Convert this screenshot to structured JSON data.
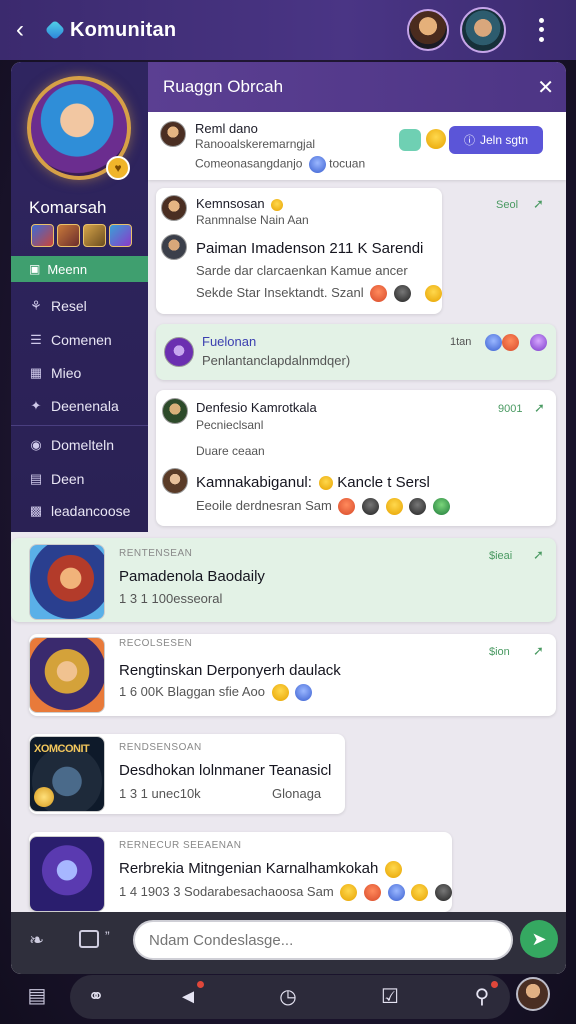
{
  "topbar": {
    "title": "Komunitan"
  },
  "sidebar": {
    "title": "Komarsah",
    "active_item": "Meenn",
    "items": [
      {
        "label": "Resel",
        "icon": "group-icon"
      },
      {
        "label": "Comenen",
        "icon": "list-icon"
      },
      {
        "label": "Mieo",
        "icon": "calendar-icon"
      },
      {
        "label": "Deenenala",
        "icon": "star-icon"
      },
      {
        "label": "Domelteln",
        "icon": "chat-icon"
      },
      {
        "label": "Deen",
        "icon": "document-icon"
      },
      {
        "label": "leadancoose",
        "icon": "image-icon"
      }
    ]
  },
  "panel": {
    "title": "Ruaggn Obrcah"
  },
  "pinned": {
    "name": "Reml dano",
    "line1": "Ranooalskeremarngjal",
    "line2": "Comeonasangdanjo",
    "line2_tail": "tocuan",
    "join_label": "Jeln sgtn"
  },
  "messages": [
    {
      "name": "Kemnsosan",
      "sub": "Ranmnalse Nain Aan",
      "main": "Paiman Imadenson 211 K Sarendi",
      "line2": "Sarde dar clarcaenkan Kamue ancer",
      "line3": "Sekde Star Insektandt. Szanl",
      "time": "Seol"
    },
    {
      "name": "Fuelonan",
      "sub": "Penlantanclapdalnmdqer)",
      "time": "1tan"
    },
    {
      "name": "Denfesio Kamrotkala",
      "sub": "Pecnieclsanl",
      "sub2": "Duare ceaan",
      "main": "Kamnakabiganul:",
      "main_tail": "Kancle t Sersl",
      "line3": "Eeoile derdnesran Sam",
      "time": "9001"
    }
  ],
  "games": [
    {
      "tag": "RENTENSEAN",
      "title": "Pamadenola Baodaily",
      "sub": "1 3  1 100esseoral",
      "time": "$ieai"
    },
    {
      "tag": "RECOLSESEN",
      "title": "Rengtinskan Derponyerh daulack",
      "sub": "1 6  00K Blaggan sfie Aoo",
      "time": "$ion"
    },
    {
      "tag": "RENDSENSOAN",
      "title": "Desdhokan lolnmaner Teanasicl",
      "sub": "1 3  1 unec10k",
      "extra": "Glonaga",
      "thumb_label": "XOMCONIT"
    },
    {
      "tag": "RERNECUR SEEAENAN",
      "title": "Rerbrekia Mitngenian Karnalhamkokah",
      "sub": "1 4 1903 3 Sodarabesachaoosa Sam"
    }
  ],
  "composer": {
    "placeholder": "Ndam Condeslasge..."
  },
  "colors": {
    "header": "#4a3585",
    "accent_green": "#3f9f6f",
    "join_button": "#5b55d8",
    "send_button": "#35a861"
  }
}
